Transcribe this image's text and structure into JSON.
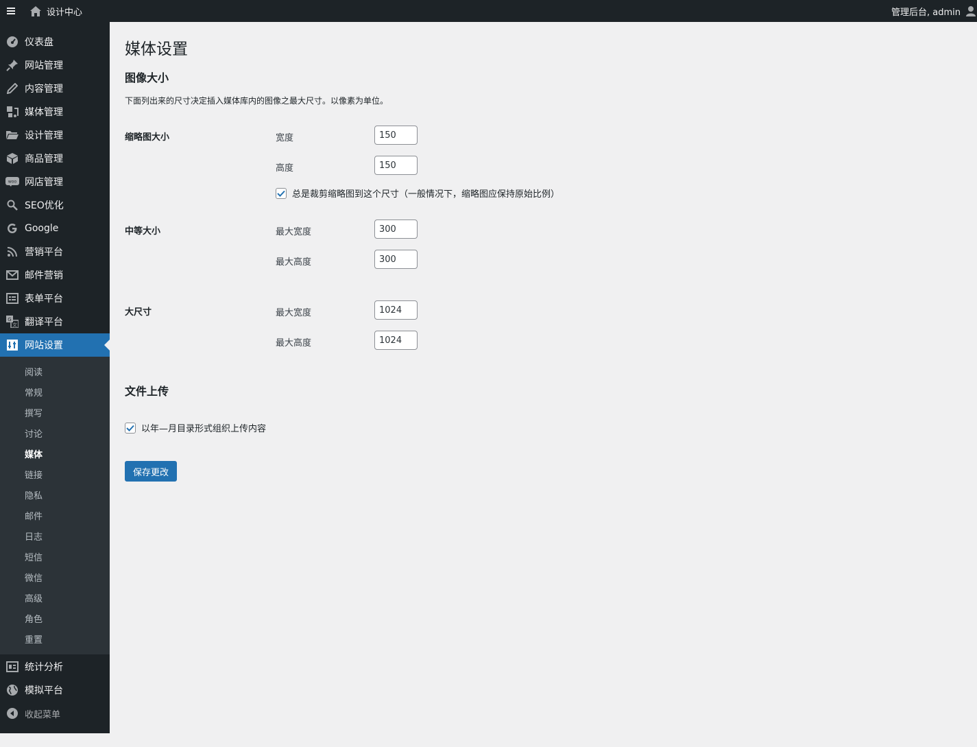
{
  "adminbar": {
    "site_name": "设计中心",
    "account_label": "管理后台, admin"
  },
  "sidebar": {
    "items": [
      {
        "label": "仪表盘",
        "icon": "dashboard-icon"
      },
      {
        "label": "网站管理",
        "icon": "pin-icon"
      },
      {
        "label": "内容管理",
        "icon": "pencil-icon"
      },
      {
        "label": "媒体管理",
        "icon": "media-icon"
      },
      {
        "label": "设计管理",
        "icon": "folder-icon"
      },
      {
        "label": "商品管理",
        "icon": "box-icon"
      },
      {
        "label": "网店管理",
        "icon": "woo-icon"
      },
      {
        "label": "SEO优化",
        "icon": "search-icon"
      },
      {
        "label": "Google",
        "icon": "google-icon"
      },
      {
        "label": "营销平台",
        "icon": "rss-icon"
      },
      {
        "label": "邮件营销",
        "icon": "mail-icon"
      },
      {
        "label": "表单平台",
        "icon": "form-icon"
      },
      {
        "label": "翻译平台",
        "icon": "translate-icon"
      },
      {
        "label": "网站设置",
        "icon": "settings-icon",
        "active": true
      }
    ],
    "submenu": [
      "阅读",
      "常规",
      "撰写",
      "讨论",
      "媒体",
      "链接",
      "隐私",
      "邮件",
      "日志",
      "短信",
      "微信",
      "高级",
      "角色",
      "重置"
    ],
    "submenu_current": "媒体",
    "after_items": [
      {
        "label": "统计分析",
        "icon": "stats-icon"
      },
      {
        "label": "模拟平台",
        "icon": "globe-icon"
      }
    ],
    "collapse_label": "收起菜单"
  },
  "page": {
    "title": "媒体设置",
    "image_sizes": {
      "heading": "图像大小",
      "description": "下面列出来的尺寸决定插入媒体库内的图像之最大尺寸。以像素为单位。",
      "thumbnail": {
        "label": "缩略图大小",
        "width_label": "宽度",
        "width": "150",
        "height_label": "高度",
        "height": "150",
        "crop_label": "总是裁剪缩略图到这个尺寸（一般情况下，缩略图应保持原始比例）",
        "crop_checked": true
      },
      "medium": {
        "label": "中等大小",
        "width_label": "最大宽度",
        "width": "300",
        "height_label": "最大高度",
        "height": "300"
      },
      "large": {
        "label": "大尺寸",
        "width_label": "最大宽度",
        "width": "1024",
        "height_label": "最大高度",
        "height": "1024"
      }
    },
    "uploads": {
      "heading": "文件上传",
      "organize_label": "以年—月目录形式组织上传内容",
      "organize_checked": true
    },
    "save_label": "保存更改"
  },
  "colors": {
    "accent": "#2271b1",
    "sidebar_bg": "#1d2327",
    "submenu_bg": "#2c3338",
    "page_bg": "#f0f0f1"
  }
}
